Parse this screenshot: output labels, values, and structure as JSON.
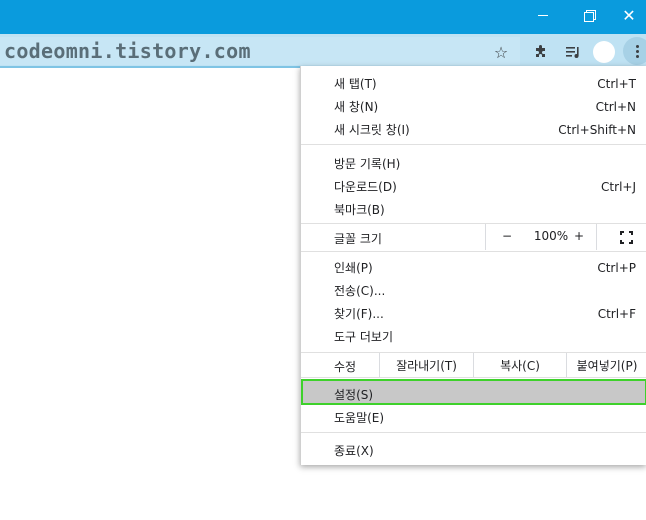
{
  "window": {
    "minimize_icon": "minimize-icon",
    "restore_icon": "restore-icon",
    "close_glyph": "✕",
    "titlebar_color": "#0a9bdd"
  },
  "toolbar": {
    "url": "codeomni.tistory.com",
    "bookmark_star": "☆",
    "extensions_glyph": "✚",
    "media_glyph": "≡",
    "color": "#bfe2f3"
  },
  "menu": {
    "new_tab": {
      "label": "새 탭(T)",
      "shortcut": "Ctrl+T"
    },
    "new_window": {
      "label": "새 창(N)",
      "shortcut": "Ctrl+N"
    },
    "new_incognito": {
      "label": "새 시크릿 창(I)",
      "shortcut": "Ctrl+Shift+N"
    },
    "history": {
      "label": "방문 기록(H)"
    },
    "downloads": {
      "label": "다운로드(D)",
      "shortcut": "Ctrl+J"
    },
    "bookmarks": {
      "label": "북마크(B)"
    },
    "zoom": {
      "label": "글꼴 크기",
      "minus": "−",
      "value": "100%",
      "plus": "+"
    },
    "print": {
      "label": "인쇄(P)",
      "shortcut": "Ctrl+P"
    },
    "cast": {
      "label": "전송(C)..."
    },
    "find": {
      "label": "찾기(F)...",
      "shortcut": "Ctrl+F"
    },
    "more_tools": {
      "label": "도구 더보기"
    },
    "edit": {
      "label": "수정",
      "cut": "잘라내기(T)",
      "copy": "복사(C)",
      "paste": "붙여넣기(P)"
    },
    "settings": {
      "label": "설정(S)"
    },
    "help": {
      "label": "도움말(E)"
    },
    "exit": {
      "label": "종료(X)"
    },
    "highlight_color": "#3ed12b"
  }
}
